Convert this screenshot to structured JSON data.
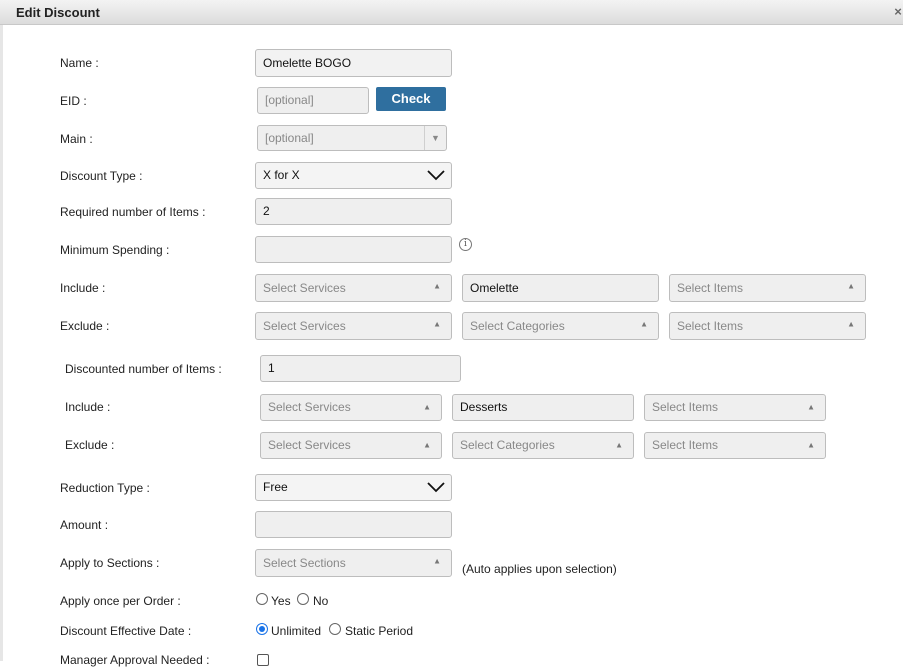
{
  "dialog": {
    "title": "Edit Discount",
    "close_glyph": "×"
  },
  "fields": {
    "name": {
      "label": "Name :",
      "value": "Omelette BOGO"
    },
    "eid": {
      "label": "EID :",
      "placeholder": "[optional]",
      "check_label": "Check"
    },
    "main": {
      "label": "Main :",
      "placeholder": "[optional]"
    },
    "discount_type": {
      "label": "Discount Type :",
      "value": "X for X"
    },
    "required_items": {
      "label": "Required number of Items :",
      "value": "2"
    },
    "minimum_spending": {
      "label": "Minimum Spending :",
      "value": "",
      "info_glyph": "i"
    },
    "include_1": {
      "label": "Include :",
      "services": "Select Services",
      "categories": "Omelette",
      "items": "Select Items"
    },
    "exclude_1": {
      "label": "Exclude :",
      "services": "Select Services",
      "categories": "Select Categories",
      "items": "Select Items"
    },
    "discounted_items": {
      "label": "Discounted number of Items :",
      "value": "1"
    },
    "include_2": {
      "label": "Include :",
      "services": "Select Services",
      "categories": "Desserts",
      "items": "Select Items"
    },
    "exclude_2": {
      "label": "Exclude :",
      "services": "Select Services",
      "categories": "Select Categories",
      "items": "Select Items"
    },
    "reduction_type": {
      "label": "Reduction Type :",
      "value": "Free"
    },
    "amount": {
      "label": "Amount :",
      "value": ""
    },
    "apply_sections": {
      "label": "Apply to Sections :",
      "placeholder": "Select Sections",
      "note": "(Auto applies upon selection)"
    },
    "apply_once": {
      "label": "Apply once per Order :",
      "options": [
        "Yes",
        "No"
      ],
      "selected": null
    },
    "effective_date": {
      "label": "Discount Effective Date :",
      "options": [
        "Unlimited",
        "Static Period"
      ],
      "selected": "Unlimited"
    },
    "manager_approval": {
      "label": "Manager Approval Needed :",
      "checked": false
    }
  }
}
